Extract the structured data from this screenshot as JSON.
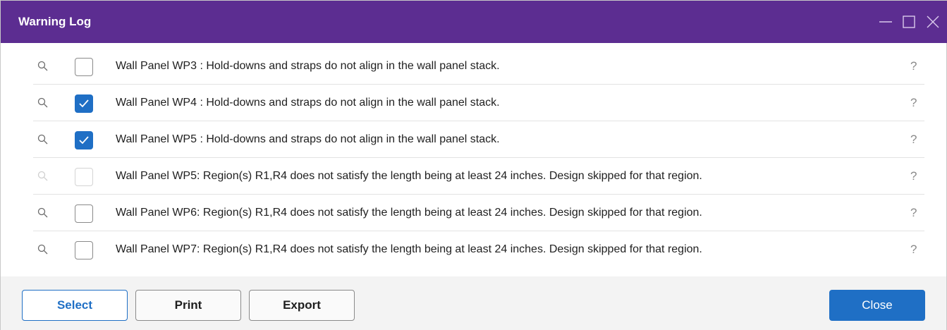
{
  "window": {
    "title": "Warning Log",
    "controls": {
      "minimize_icon": "minimize-icon",
      "maximize_icon": "maximize-icon",
      "close_icon": "close-icon"
    }
  },
  "warnings": [
    {
      "message": "Wall Panel WP3 : Hold-downs and straps do not align in the wall panel stack.",
      "checked": false,
      "disabled": false,
      "help": "?"
    },
    {
      "message": "Wall Panel WP4 : Hold-downs and straps do not align in the wall panel stack.",
      "checked": true,
      "disabled": false,
      "help": "?"
    },
    {
      "message": "Wall Panel WP5 : Hold-downs and straps do not align in the wall panel stack.",
      "checked": true,
      "disabled": false,
      "help": "?"
    },
    {
      "message": "Wall Panel WP5: Region(s) R1,R4 does not satisfy the length being at least 24 inches. Design skipped for that region.",
      "checked": false,
      "disabled": true,
      "help": "?"
    },
    {
      "message": "Wall Panel WP6: Region(s) R1,R4 does not satisfy the length being at least 24 inches. Design skipped for that region.",
      "checked": false,
      "disabled": false,
      "help": "?"
    },
    {
      "message": "Wall Panel WP7: Region(s) R1,R4 does not satisfy the length being at least 24 inches. Design skipped for that region.",
      "checked": false,
      "disabled": false,
      "help": "?"
    }
  ],
  "footer": {
    "select_label": "Select",
    "print_label": "Print",
    "export_label": "Export",
    "close_label": "Close"
  },
  "colors": {
    "titlebar": "#5c2d91",
    "accent": "#1f6fc5",
    "footer_bg": "#f3f3f3"
  }
}
